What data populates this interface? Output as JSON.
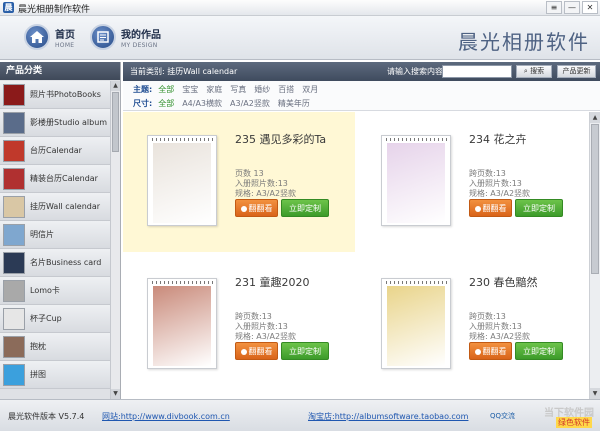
{
  "window": {
    "title": "晨光相册制作软件",
    "icon_text": "晨",
    "buttons": [
      "≡",
      "—",
      "✕"
    ]
  },
  "header": {
    "nav": [
      {
        "label": "首页",
        "sub": "HOME",
        "icon": "home-icon"
      },
      {
        "label": "我的作品",
        "sub": "MY DESIGN",
        "icon": "design-icon"
      }
    ],
    "brand": "晨光相册软件"
  },
  "sidebar": {
    "heading": "产品分类",
    "items": [
      {
        "label": "照片书PhotoBooks",
        "color": "#8b1a1a"
      },
      {
        "label": "影楼册Studio album",
        "color": "#5a6c8a"
      },
      {
        "label": "台历Calendar",
        "color": "#c0392b"
      },
      {
        "label": "精装台历Calendar",
        "color": "#b03030"
      },
      {
        "label": "挂历Wall calendar",
        "color": "#d9c7a5"
      },
      {
        "label": "明信片",
        "color": "#7fa7cf"
      },
      {
        "label": "名片Business card",
        "color": "#2b3a55"
      },
      {
        "label": "Lomo卡",
        "color": "#a9a9a9"
      },
      {
        "label": "杯子Cup",
        "color": "#e6e6e6"
      },
      {
        "label": "抱枕",
        "color": "#8b6b5a"
      },
      {
        "label": "拼图",
        "color": "#3ba0dd"
      }
    ]
  },
  "toolbar": {
    "current_category": "当前类别: 挂历Wall calendar",
    "search_label": "请输入搜索内容:",
    "search_value": "",
    "search_button": "搜索",
    "update_button": "产品更新"
  },
  "filters": {
    "theme_label": "主题:",
    "theme_options": [
      "全部",
      "宝宝",
      "家庭",
      "写真",
      "婚纱",
      "百搭",
      "双月"
    ],
    "size_label": "尺寸:",
    "size_options": [
      "全部",
      "A4/A3横款",
      "A3/A2竖款",
      "精美年历"
    ]
  },
  "products": [
    {
      "title": "235 遇见多彩的Ta",
      "pages": "页数  13",
      "photos": "入册照片数:13",
      "spec": "规格: A3/A2竖款",
      "photo_color": "#e9e3dc",
      "selected": true
    },
    {
      "title": "234 花之卉",
      "pages": "跨页数:13",
      "photos": "入册照片数:13",
      "spec": "规格: A3/A2竖款",
      "photo_color": "#e6d3ea",
      "selected": false
    },
    {
      "title": "231 童趣2020",
      "pages": "跨页数:13",
      "photos": "入册照片数:13",
      "spec": "规格: A3/A2竖款",
      "photo_color": "#c98a7a",
      "selected": false
    },
    {
      "title": "230 春色黯然",
      "pages": "跨页数:13",
      "photos": "入册照片数:13",
      "spec": "规格: A3/A2竖款",
      "photo_color": "#e9d48a",
      "selected": false
    }
  ],
  "card_buttons": {
    "flip": "翻翻看",
    "order": "立即定制"
  },
  "status": {
    "version": "晨光软件版本 V5.7.4",
    "site": "网站:http://www.divbook.com.cn",
    "shop": "淘宝店:http://albumsoftware.taobao.com",
    "qq": "QQ交流",
    "watermark": "当下软件园",
    "watermark_sub": "绿色软件"
  }
}
